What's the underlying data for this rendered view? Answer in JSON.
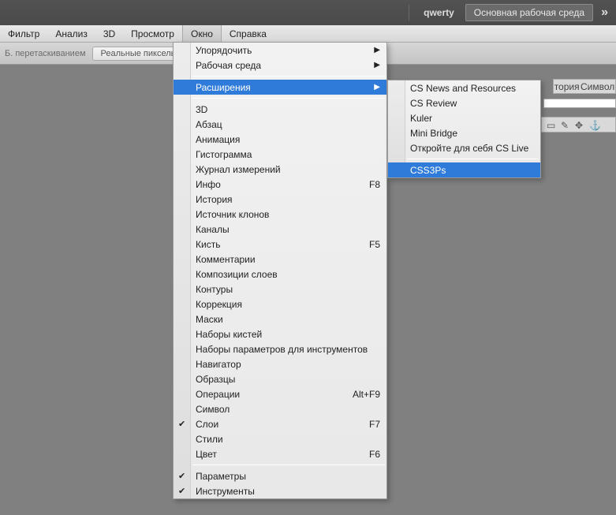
{
  "titlebar": {
    "user": "qwerty",
    "workspace_button": "Основная рабочая среда",
    "expand": "»"
  },
  "menubar": {
    "items": [
      "Фильтр",
      "Анализ",
      "3D",
      "Просмотр",
      "Окно",
      "Справка"
    ],
    "active_index": 4
  },
  "toolbar": {
    "drag_hint": "Б. перетаскиванием",
    "real_pixels": "Реальные пикселы"
  },
  "window_menu": {
    "top": [
      {
        "label": "Упорядочить",
        "sub": true
      },
      {
        "label": "Рабочая среда",
        "sub": true
      }
    ],
    "extensions": {
      "label": "Расширения",
      "sub": true,
      "highlight": true
    },
    "middle": [
      {
        "label": "3D"
      },
      {
        "label": "Абзац"
      },
      {
        "label": "Анимация"
      },
      {
        "label": "Гистограмма"
      },
      {
        "label": "Журнал измерений"
      },
      {
        "label": "Инфо",
        "shortcut": "F8"
      },
      {
        "label": "История"
      },
      {
        "label": "Источник клонов"
      },
      {
        "label": "Каналы"
      },
      {
        "label": "Кисть",
        "shortcut": "F5"
      },
      {
        "label": "Комментарии"
      },
      {
        "label": "Композиции слоев"
      },
      {
        "label": "Контуры"
      },
      {
        "label": "Коррекция"
      },
      {
        "label": "Маски"
      },
      {
        "label": "Наборы кистей"
      },
      {
        "label": "Наборы параметров для инструментов"
      },
      {
        "label": "Навигатор"
      },
      {
        "label": "Образцы"
      },
      {
        "label": "Операции",
        "shortcut": "Alt+F9"
      },
      {
        "label": "Символ"
      },
      {
        "label": "Слои",
        "shortcut": "F7",
        "checked": true
      },
      {
        "label": "Стили"
      },
      {
        "label": "Цвет",
        "shortcut": "F6"
      }
    ],
    "bottom": [
      {
        "label": "Параметры",
        "checked": true
      },
      {
        "label": "Инструменты",
        "checked": true
      }
    ]
  },
  "extensions_submenu": {
    "items": [
      {
        "label": "CS News and Resources"
      },
      {
        "label": "CS Review"
      },
      {
        "label": "Kuler"
      },
      {
        "label": "Mini Bridge"
      },
      {
        "label": "Откройте для себя CS Live"
      }
    ],
    "highlight": {
      "label": "CSS3Ps"
    }
  },
  "right_panel": {
    "tab1": "тория",
    "tab2": "Символ"
  }
}
